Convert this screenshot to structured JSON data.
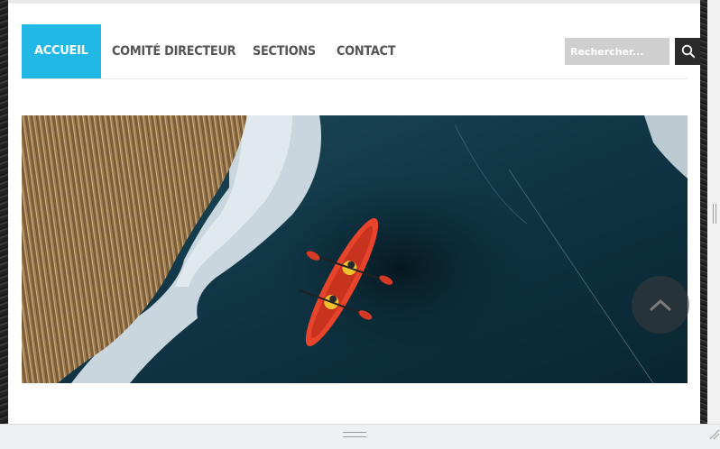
{
  "nav": {
    "items": [
      {
        "label": "ACCUEIL",
        "active": true
      },
      {
        "label": "COMITÉ DIRECTEUR",
        "active": false
      },
      {
        "label": "SECTIONS",
        "active": false
      },
      {
        "label": "CONTACT",
        "active": false
      }
    ]
  },
  "search": {
    "placeholder": "Rechercher...",
    "value": ""
  },
  "hero": {
    "alt": "Kayak sur un lac partiellement gelé"
  },
  "icons": {
    "search": "search-icon",
    "scroll_top": "chevron-up-icon"
  },
  "colors": {
    "accent": "#22b8e6",
    "nav_text": "#555555",
    "search_bg": "#cfcfcf",
    "search_button": "#2b2b2b"
  }
}
